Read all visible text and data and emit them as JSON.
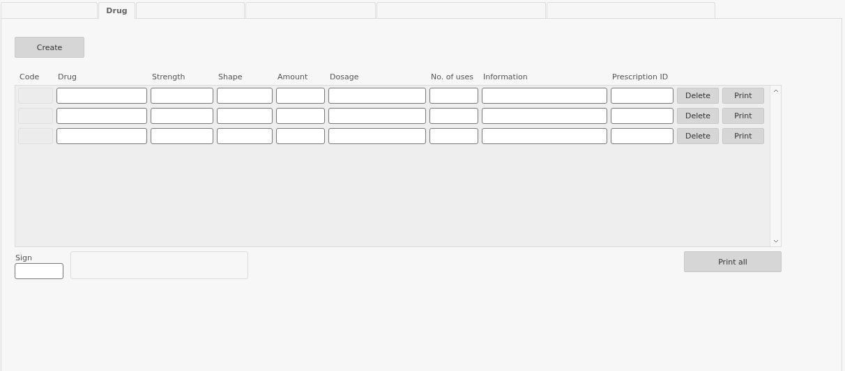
{
  "tabs": [
    {
      "selected": false
    },
    {
      "label": "Drug",
      "selected": true
    },
    {
      "selected": false
    },
    {
      "selected": false
    },
    {
      "selected": false
    },
    {
      "selected": false
    }
  ],
  "create_button": "Create",
  "table": {
    "columns": [
      "Code",
      "Drug",
      "Strength",
      "Shape",
      "Amount",
      "Dosage",
      "No. of uses",
      "Information",
      "Prescription ID"
    ],
    "rows": [
      {
        "code_disabled": true,
        "delete": "Delete",
        "print": "Print"
      },
      {
        "code_disabled": true,
        "delete": "Delete",
        "print": "Print"
      },
      {
        "code_disabled": true,
        "delete": "Delete",
        "print": "Print"
      }
    ]
  },
  "sign": {
    "label": "Sign"
  },
  "print_all_button": "Print all"
}
